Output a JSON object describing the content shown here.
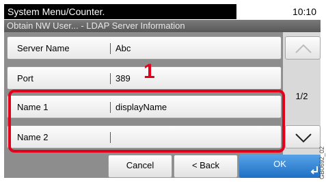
{
  "header": {
    "title": "System Menu/Counter.",
    "time": "10:10",
    "subtitle": "Obtain NW User... - LDAP Server Information"
  },
  "rows": [
    {
      "label": "Server Name",
      "value": "Abc"
    },
    {
      "label": "Port",
      "value": "389"
    },
    {
      "label": "Name 1",
      "value": "displayName"
    },
    {
      "label": "Name 2",
      "value": ""
    }
  ],
  "pager": {
    "indicator": "1/2",
    "up_icon": "chevron-up-icon",
    "down_icon": "chevron-down-icon"
  },
  "callout": "1",
  "buttons": {
    "cancel": "Cancel",
    "back": "< Back",
    "ok": "OK"
  },
  "figure_code": "GB0692_02",
  "colors": {
    "highlight": "#e3001b",
    "ok_button": "#2f86d8",
    "title_bar": "#000000"
  }
}
